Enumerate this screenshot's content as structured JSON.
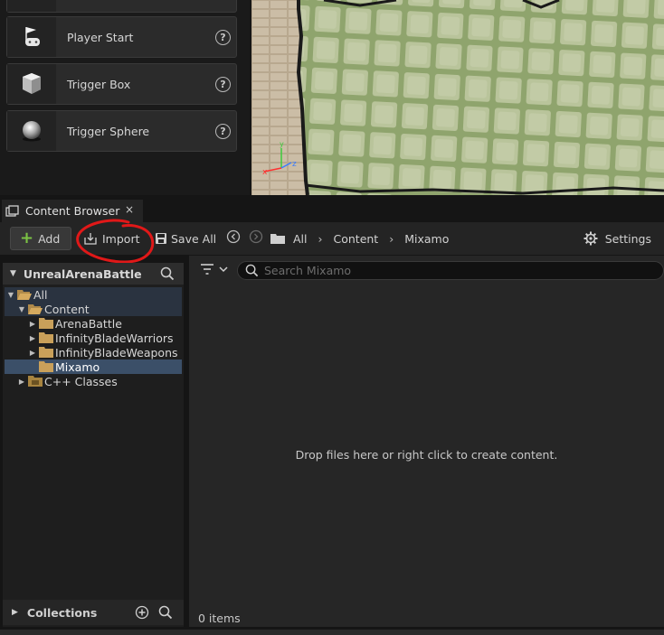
{
  "place_actors": {
    "items": [
      {
        "label": "Player Start",
        "icon": "player-start-icon"
      },
      {
        "label": "Trigger Box",
        "icon": "trigger-box-icon"
      },
      {
        "label": "Trigger Sphere",
        "icon": "trigger-sphere-icon"
      }
    ],
    "help_glyph": "?"
  },
  "content_browser": {
    "tab_title": "Content Browser",
    "tab_close": "×",
    "toolbar": {
      "add_label": "Add",
      "import_label": "Import",
      "save_all_label": "Save All",
      "settings_label": "Settings"
    },
    "breadcrumbs": [
      "All",
      "Content",
      "Mixamo"
    ],
    "breadcrumb_separator": "›",
    "sources": {
      "project_name": "UnrealArenaBattle",
      "tree": [
        {
          "label": "All",
          "depth": 0,
          "expanded": true
        },
        {
          "label": "Content",
          "depth": 1,
          "expanded": true
        },
        {
          "label": "ArenaBattle",
          "depth": 2,
          "expanded": false
        },
        {
          "label": "InfinityBladeWarriors",
          "depth": 2,
          "expanded": false
        },
        {
          "label": "InfinityBladeWeapons",
          "depth": 2,
          "expanded": false
        },
        {
          "label": "Mixamo",
          "depth": 2,
          "selected": true
        },
        {
          "label": "C++ Classes",
          "depth": 1,
          "expanded": false
        }
      ],
      "collections_label": "Collections"
    },
    "search_placeholder": "Search Mixamo",
    "empty_message": "Drop files here or right click to create content.",
    "item_count": "0 items"
  },
  "colors": {
    "accent_add": "#7bc244",
    "selection": "#3b4f68",
    "annotation": "#e01818"
  }
}
